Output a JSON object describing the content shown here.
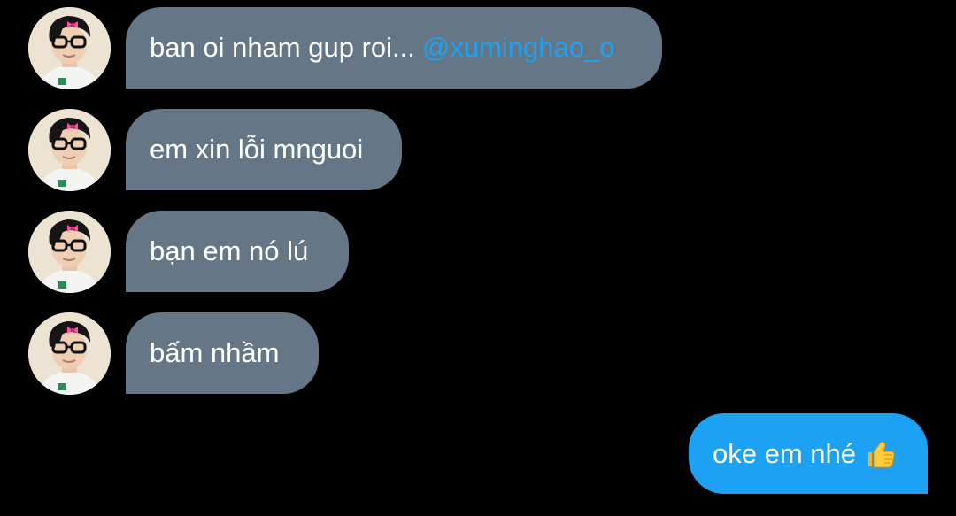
{
  "conversation": {
    "incoming": [
      {
        "text": "ban oi nham gup roi...",
        "mention": "@xuminghao_o"
      },
      {
        "text": "em xin lỗi mnguoi"
      },
      {
        "text": "bạn em nó lú"
      },
      {
        "text": "bấm nhầm"
      }
    ],
    "outgoing": [
      {
        "text": "oke em nhé",
        "emoji": "thumbs-up-icon"
      }
    ]
  },
  "colors": {
    "background": "#000000",
    "incoming_bubble": "#657786",
    "outgoing_bubble": "#1da1f2",
    "mention": "#1da1f2",
    "text": "#ffffff"
  }
}
